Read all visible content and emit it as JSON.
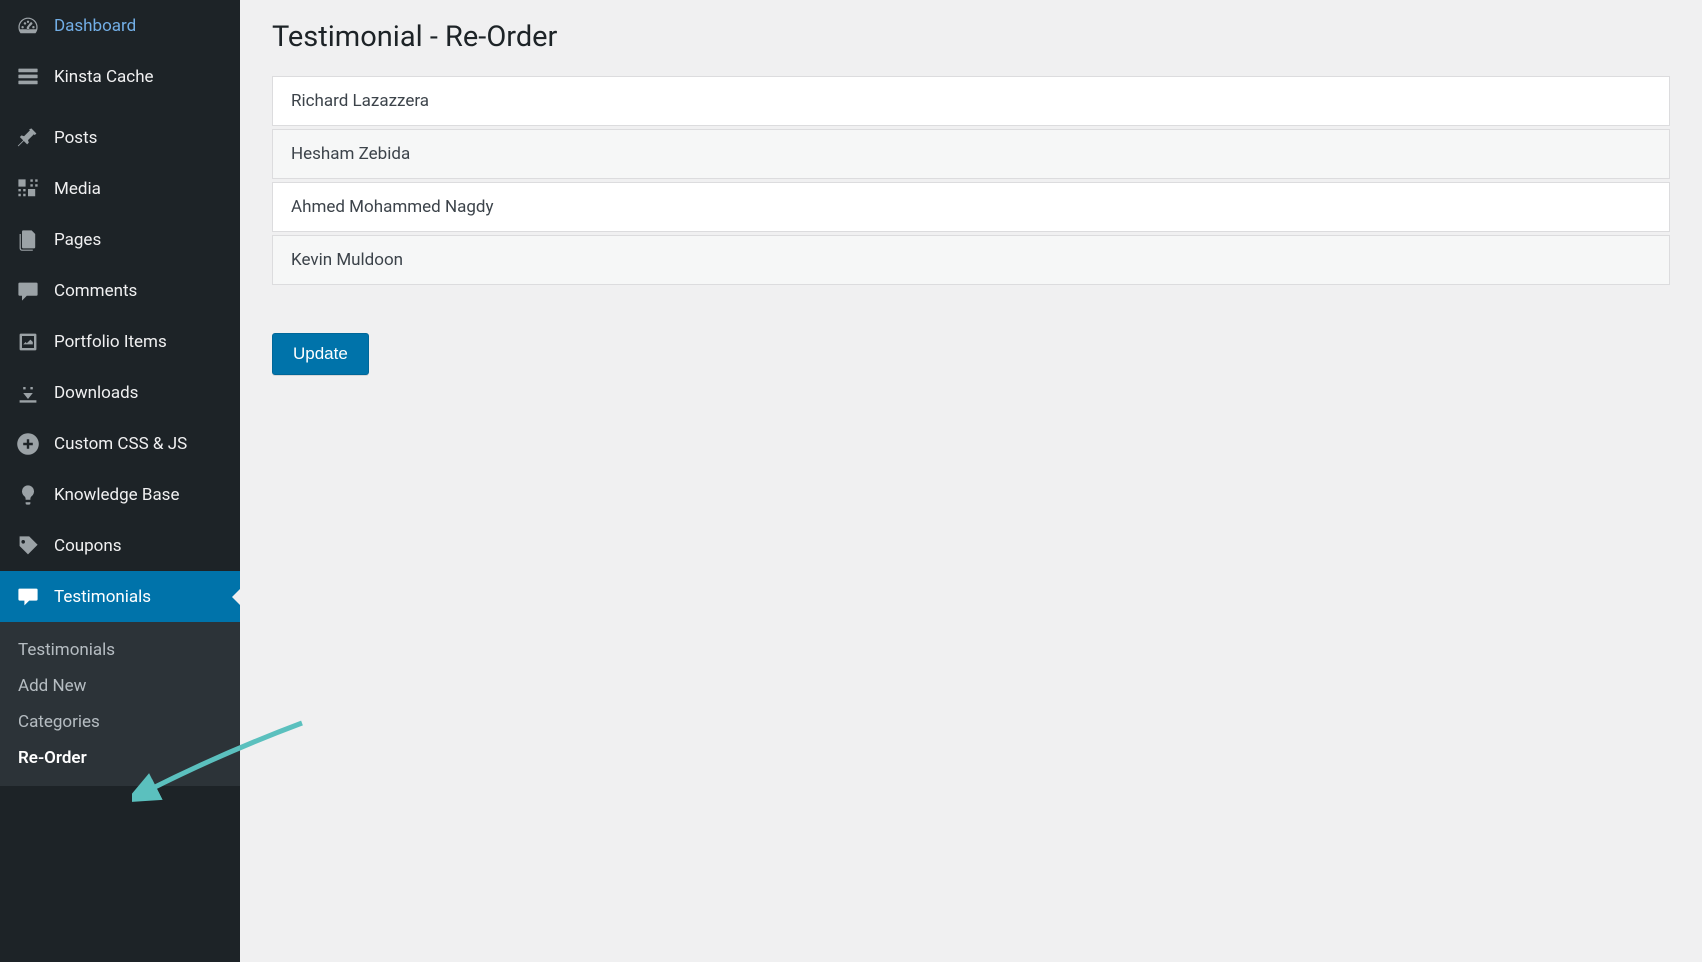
{
  "sidebar": {
    "items": [
      {
        "label": "Dashboard",
        "icon": "dashboard"
      },
      {
        "label": "Kinsta Cache",
        "icon": "cache"
      },
      {
        "label": "Posts",
        "icon": "pin"
      },
      {
        "label": "Media",
        "icon": "media"
      },
      {
        "label": "Pages",
        "icon": "pages"
      },
      {
        "label": "Comments",
        "icon": "comments"
      },
      {
        "label": "Portfolio Items",
        "icon": "portfolio"
      },
      {
        "label": "Downloads",
        "icon": "downloads"
      },
      {
        "label": "Custom CSS & JS",
        "icon": "plus-circle"
      },
      {
        "label": "Knowledge Base",
        "icon": "bulb"
      },
      {
        "label": "Coupons",
        "icon": "tag"
      },
      {
        "label": "Testimonials",
        "icon": "testimonials",
        "active": true
      }
    ],
    "submenu": [
      {
        "label": "Testimonials"
      },
      {
        "label": "Add New"
      },
      {
        "label": "Categories"
      },
      {
        "label": "Re-Order",
        "current": true
      }
    ]
  },
  "main": {
    "title": "Testimonial - Re-Order",
    "items": [
      {
        "name": "Richard Lazazzera"
      },
      {
        "name": "Hesham Zebida"
      },
      {
        "name": "Ahmed Mohammed Nagdy"
      },
      {
        "name": "Kevin Muldoon"
      }
    ],
    "update_label": "Update"
  }
}
